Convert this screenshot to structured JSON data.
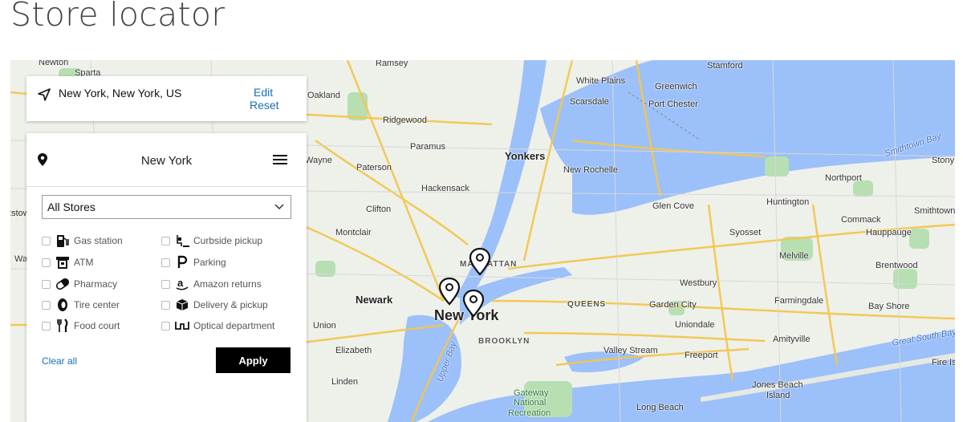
{
  "page": {
    "title": "Store locator"
  },
  "location_card": {
    "location": "New York, New York, US",
    "edit_label": "Edit",
    "reset_label": "Reset"
  },
  "panel": {
    "region": "New York",
    "select": {
      "value": "All Stores"
    },
    "filters": [
      {
        "label": "Gas station",
        "icon": "gas-pump-icon",
        "checked": false
      },
      {
        "label": "ATM",
        "icon": "atm-icon",
        "checked": false
      },
      {
        "label": "Pharmacy",
        "icon": "pill-icon",
        "checked": false
      },
      {
        "label": "Tire center",
        "icon": "tire-icon",
        "checked": false
      },
      {
        "label": "Food court",
        "icon": "fork-knife-icon",
        "checked": false
      },
      {
        "label": "Curbside pickup",
        "icon": "curbside-icon",
        "checked": false
      },
      {
        "label": "Parking",
        "icon": "parking-icon",
        "checked": false
      },
      {
        "label": "Amazon returns",
        "icon": "amazon-icon",
        "checked": false
      },
      {
        "label": "Delivery & pickup",
        "icon": "box-icon",
        "checked": false
      },
      {
        "label": "Optical department",
        "icon": "glasses-icon",
        "checked": false
      }
    ],
    "clear_label": "Clear all",
    "apply_label": "Apply"
  },
  "map": {
    "labels": {
      "newton": "Newton",
      "sparta": "Sparta",
      "ramsey": "Ramsey",
      "stamford": "Stamford",
      "white_plains": "White Plains",
      "greenwich": "Greenwich",
      "oakland": "Oakland",
      "scarsdale": "Scarsdale",
      "port_chester": "Port Chester",
      "ridgewood": "Ridgewood",
      "paramus": "Paramus",
      "yonkers": "Yonkers",
      "smithtown_bay": "Smithtown Bay",
      "stony_b": "Stony B",
      "wayne": "Wayne",
      "paterson": "Paterson",
      "new_rochelle": "New Rochelle",
      "northport": "Northport",
      "hackensack": "Hackensack",
      "huntington": "Huntington",
      "glen_cove": "Glen Cove",
      "ttstown": "ttstown",
      "clifton": "Clifton",
      "commack": "Commack",
      "smithtown": "Smithtown",
      "montclair": "Montclair",
      "syosset": "Syosset",
      "hauppauge": "Hauppauge",
      "manhattan": "MANHATTAN",
      "melville": "Melville",
      "brentwood": "Brentwood",
      "wa": "Wa",
      "westbury": "Westbury",
      "newark": "Newark",
      "queens": "QUEENS",
      "garden_city": "Garden City",
      "farmingdale": "Farmingdale",
      "bay_shore": "Bay Shore",
      "new_york": "New York",
      "union": "Union",
      "uniondale": "Uniondale",
      "brooklyn": "BROOKLYN",
      "amityville": "Amityville",
      "great_south_bay": "Great South Bay",
      "elizabeth": "Elizabeth",
      "valley_stream": "Valley Stream",
      "freeport": "Freeport",
      "fire_isla": "Fire Isla",
      "upper_bay": "Upper Bay",
      "linden": "Linden",
      "jones_beach": "Jones Beach",
      "island": "Island",
      "gateway": "Gateway",
      "national": "National",
      "recreation": "Recreation",
      "long_beach": "Long Beach"
    }
  }
}
